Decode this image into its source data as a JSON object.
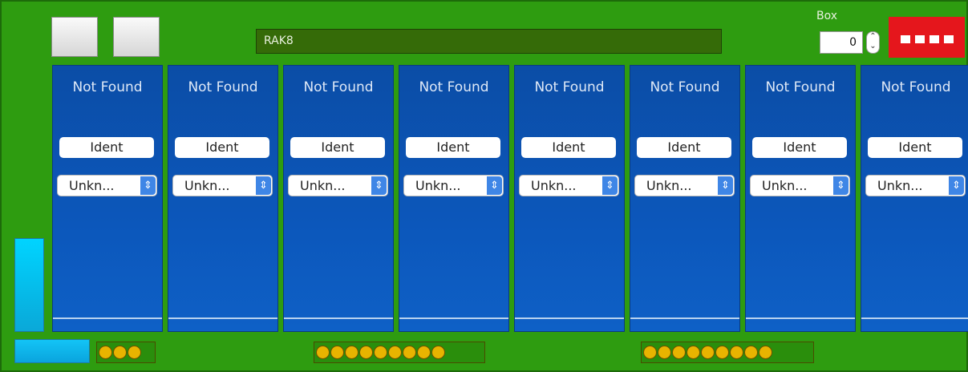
{
  "header": {
    "name_field": "RAK8",
    "box_label": "Box",
    "box_value": "0"
  },
  "slots": [
    {
      "status": "Not Found",
      "ident_label": "Ident",
      "type_value": "Unkn..."
    },
    {
      "status": "Not Found",
      "ident_label": "Ident",
      "type_value": "Unkn..."
    },
    {
      "status": "Not Found",
      "ident_label": "Ident",
      "type_value": "Unkn..."
    },
    {
      "status": "Not Found",
      "ident_label": "Ident",
      "type_value": "Unkn..."
    },
    {
      "status": "Not Found",
      "ident_label": "Ident",
      "type_value": "Unkn..."
    },
    {
      "status": "Not Found",
      "ident_label": "Ident",
      "type_value": "Unkn..."
    },
    {
      "status": "Not Found",
      "ident_label": "Ident",
      "type_value": "Unkn..."
    },
    {
      "status": "Not Found",
      "ident_label": "Ident",
      "type_value": "Unkn..."
    }
  ],
  "dip_switch_count": 4,
  "led_strips": [
    {
      "count": 3
    },
    {
      "count": 9
    },
    {
      "count": 9
    }
  ],
  "colors": {
    "board": "#2e9c10",
    "slot": "#0c57bb",
    "dip": "#e5161c",
    "led": "#e8b400",
    "accent": "#00d4ff"
  }
}
